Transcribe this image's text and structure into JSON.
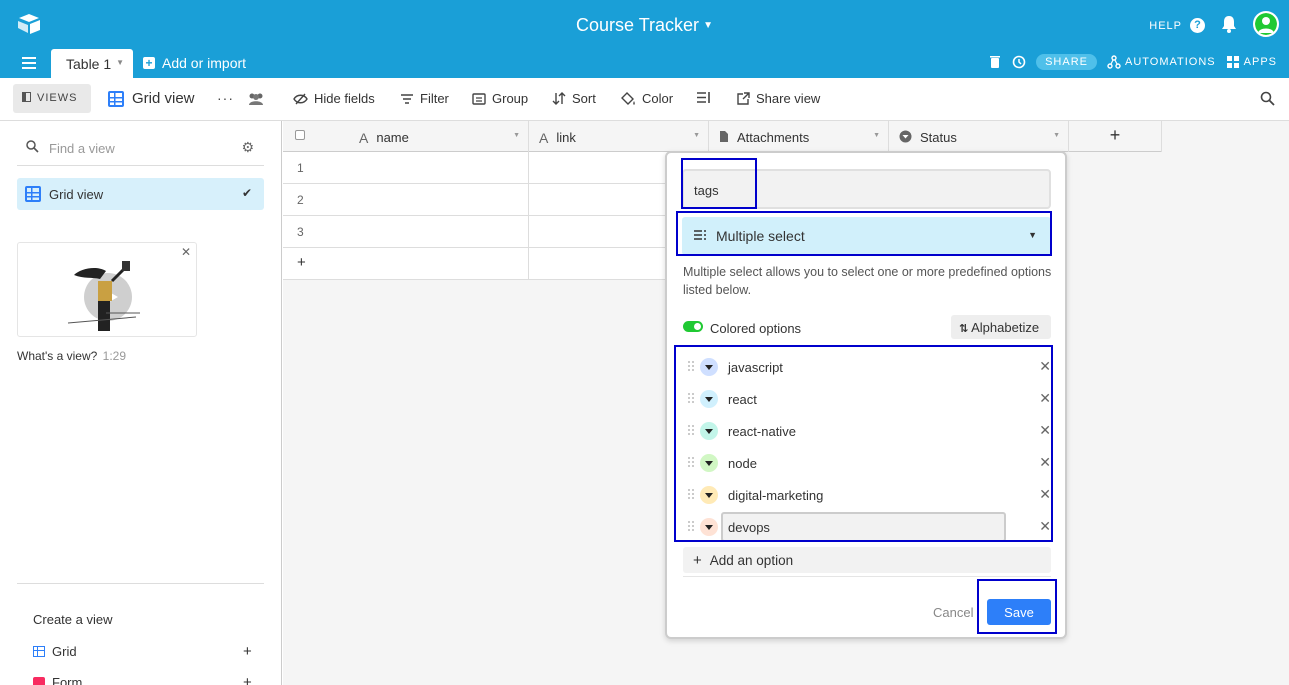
{
  "app": {
    "base_title": "Course Tracker",
    "help_label": "HELP",
    "help_icon_glyph": "?"
  },
  "tabs": {
    "active_table": "Table 1",
    "add_import": "Add or import"
  },
  "top_actions": {
    "share": "SHARE",
    "automations": "AUTOMATIONS",
    "apps": "APPS"
  },
  "viewbar": {
    "views_label": "VIEWS",
    "current_view": "Grid view",
    "more": "···",
    "hide_fields": "Hide fields",
    "filter": "Filter",
    "group": "Group",
    "sort": "Sort",
    "color": "Color",
    "share_view": "Share view"
  },
  "sidebar": {
    "find_placeholder": "Find a view",
    "gear_glyph": "⚙",
    "views": [
      {
        "label": "Grid view",
        "selected": true
      }
    ],
    "check_glyph": "✔",
    "video_caption": "What's a view?",
    "video_duration": "1:29",
    "close_glyph": "✕",
    "create_view_label": "Create a view",
    "create_items": [
      {
        "label": "Grid",
        "icon": "grid-icon"
      },
      {
        "label": "Form",
        "icon": "form-icon"
      }
    ],
    "plus_glyph": "+"
  },
  "grid": {
    "columns": [
      {
        "label": "name",
        "icon": "text-icon"
      },
      {
        "label": "link",
        "icon": "text-icon"
      },
      {
        "label": "Attachments",
        "icon": "attachment-icon"
      },
      {
        "label": "Status",
        "icon": "single-select-icon"
      }
    ],
    "add_column_glyph": "+",
    "rows": [
      "1",
      "2",
      "3"
    ],
    "add_row_glyph": "+"
  },
  "field_dialog": {
    "field_name": "tags",
    "field_type": "Multiple select",
    "description": "Multiple select allows you to select one or more predefined options listed below.",
    "colored_options_label": "Colored options",
    "colored_options_on": true,
    "alphabetize_label": "Alphabetize",
    "options": [
      {
        "label": "javascript",
        "color": "#cfdfff"
      },
      {
        "label": "react",
        "color": "#d0f0fd"
      },
      {
        "label": "react-native",
        "color": "#c2f5e9"
      },
      {
        "label": "node",
        "color": "#d1f7c4"
      },
      {
        "label": "digital-marketing",
        "color": "#ffeab6"
      },
      {
        "label": "devops",
        "color": "#fee2d5"
      }
    ],
    "remove_glyph": "✕",
    "add_option_label": "Add an option",
    "cancel_label": "Cancel",
    "save_label": "Save"
  },
  "colors": {
    "brand_blue": "#1a9fd7",
    "primary_button": "#2d7ff9",
    "toggle_on": "#20c933",
    "selected_view_bg": "#d7f0fb",
    "annotation_box": "#0000cc"
  }
}
